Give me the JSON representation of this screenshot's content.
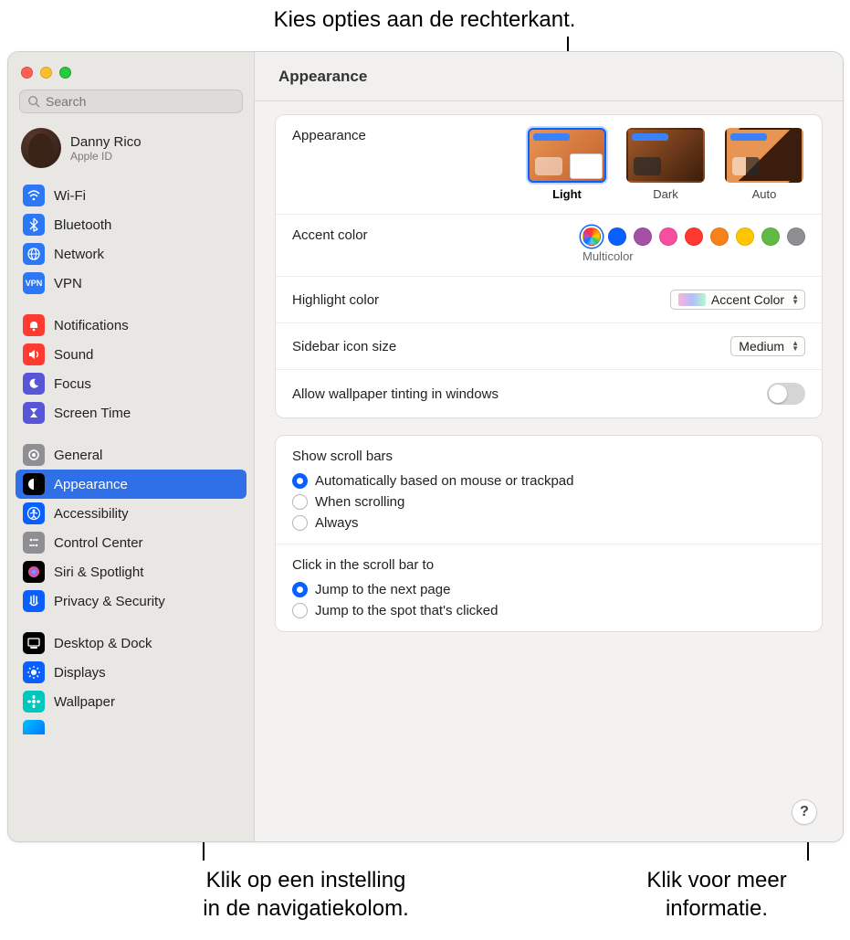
{
  "callouts": {
    "top": "Kies opties aan de rechterkant.",
    "bottom_left": "Klik op een instelling\nin de navigatiekolom.",
    "bottom_right": "Klik voor meer\ninformatie."
  },
  "search": {
    "placeholder": "Search"
  },
  "user": {
    "name": "Danny Rico",
    "sub": "Apple ID"
  },
  "sidebar": {
    "groups": [
      [
        {
          "label": "Wi-Fi",
          "icon": "wifi",
          "bg": "#2b77f5"
        },
        {
          "label": "Bluetooth",
          "icon": "bluetooth",
          "bg": "#2b77f5"
        },
        {
          "label": "Network",
          "icon": "network",
          "bg": "#2b77f5"
        },
        {
          "label": "VPN",
          "icon": "vpn",
          "bg": "#2b77f5"
        }
      ],
      [
        {
          "label": "Notifications",
          "icon": "bell",
          "bg": "#ff3b30"
        },
        {
          "label": "Sound",
          "icon": "sound",
          "bg": "#ff3b30"
        },
        {
          "label": "Focus",
          "icon": "moon",
          "bg": "#5856d6"
        },
        {
          "label": "Screen Time",
          "icon": "hourglass",
          "bg": "#5856d6"
        }
      ],
      [
        {
          "label": "General",
          "icon": "gear",
          "bg": "#8e8e93"
        },
        {
          "label": "Appearance",
          "icon": "appearance",
          "bg": "#000",
          "selected": true
        },
        {
          "label": "Accessibility",
          "icon": "accessibility",
          "bg": "#0a60ff"
        },
        {
          "label": "Control Center",
          "icon": "control-center",
          "bg": "#8e8e93"
        },
        {
          "label": "Siri & Spotlight",
          "icon": "siri",
          "bg": "#000"
        },
        {
          "label": "Privacy & Security",
          "icon": "privacy",
          "bg": "#0a60ff"
        }
      ],
      [
        {
          "label": "Desktop & Dock",
          "icon": "dock",
          "bg": "#000"
        },
        {
          "label": "Displays",
          "icon": "displays",
          "bg": "#0a60ff"
        },
        {
          "label": "Wallpaper",
          "icon": "wallpaper",
          "bg": "#00c7be"
        }
      ]
    ]
  },
  "title": "Appearance",
  "appearance_section": {
    "label": "Appearance",
    "options": [
      {
        "label": "Light",
        "selected": true
      },
      {
        "label": "Dark",
        "selected": false
      },
      {
        "label": "Auto",
        "selected": false
      }
    ]
  },
  "accent": {
    "label": "Accent color",
    "sub": "Multicolor",
    "colors": [
      "multi",
      "#0a60ff",
      "#a550a7",
      "#f74f9e",
      "#ff3830",
      "#f7821b",
      "#ffc600",
      "#62ba46",
      "#8e8e93"
    ]
  },
  "highlight": {
    "label": "Highlight color",
    "value": "Accent Color"
  },
  "iconsize": {
    "label": "Sidebar icon size",
    "value": "Medium"
  },
  "tinting": {
    "label": "Allow wallpaper tinting in windows",
    "on": false
  },
  "scrollbars": {
    "label": "Show scroll bars",
    "options": [
      {
        "label": "Automatically based on mouse or trackpad",
        "checked": true
      },
      {
        "label": "When scrolling",
        "checked": false
      },
      {
        "label": "Always",
        "checked": false
      }
    ]
  },
  "clickscroll": {
    "label": "Click in the scroll bar to",
    "options": [
      {
        "label": "Jump to the next page",
        "checked": true
      },
      {
        "label": "Jump to the spot that's clicked",
        "checked": false
      }
    ]
  },
  "help": "?"
}
